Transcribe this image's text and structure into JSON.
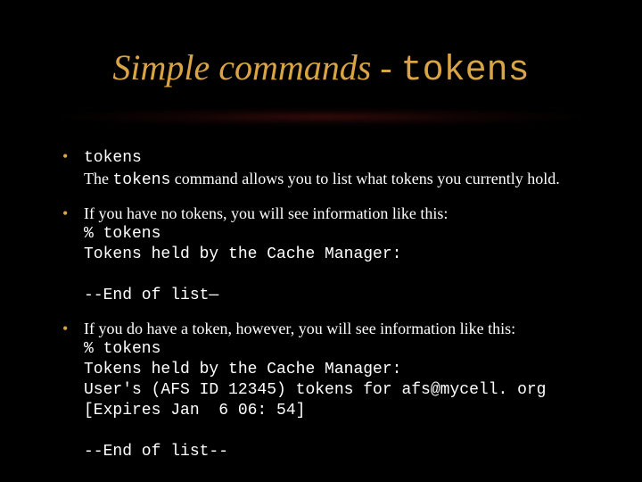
{
  "title": {
    "prefix": "Simple commands - ",
    "mono": "tokens"
  },
  "bullets": [
    {
      "lead_mono": "tokens",
      "lead_plain": "",
      "desc_pre": "The ",
      "desc_mono": "tokens",
      "desc_post": " command allows you to list what tokens you currently hold.",
      "code": ""
    },
    {
      "lead_mono": "",
      "lead_plain": "If you have no tokens, you will see information like this:",
      "desc_pre": "",
      "desc_mono": "",
      "desc_post": "",
      "code": "% tokens\nTokens held by the Cache Manager:\n\n--End of list—"
    },
    {
      "lead_mono": "",
      "lead_plain": "If you do have a token, however, you will see information like this:",
      "desc_pre": "",
      "desc_mono": "",
      "desc_post": "",
      "code": "% tokens\nTokens held by the Cache Manager:\nUser's (AFS ID 12345) tokens for afs@mycell. org\n[Expires Jan  6 06: 54]\n\n--End of list--"
    }
  ]
}
